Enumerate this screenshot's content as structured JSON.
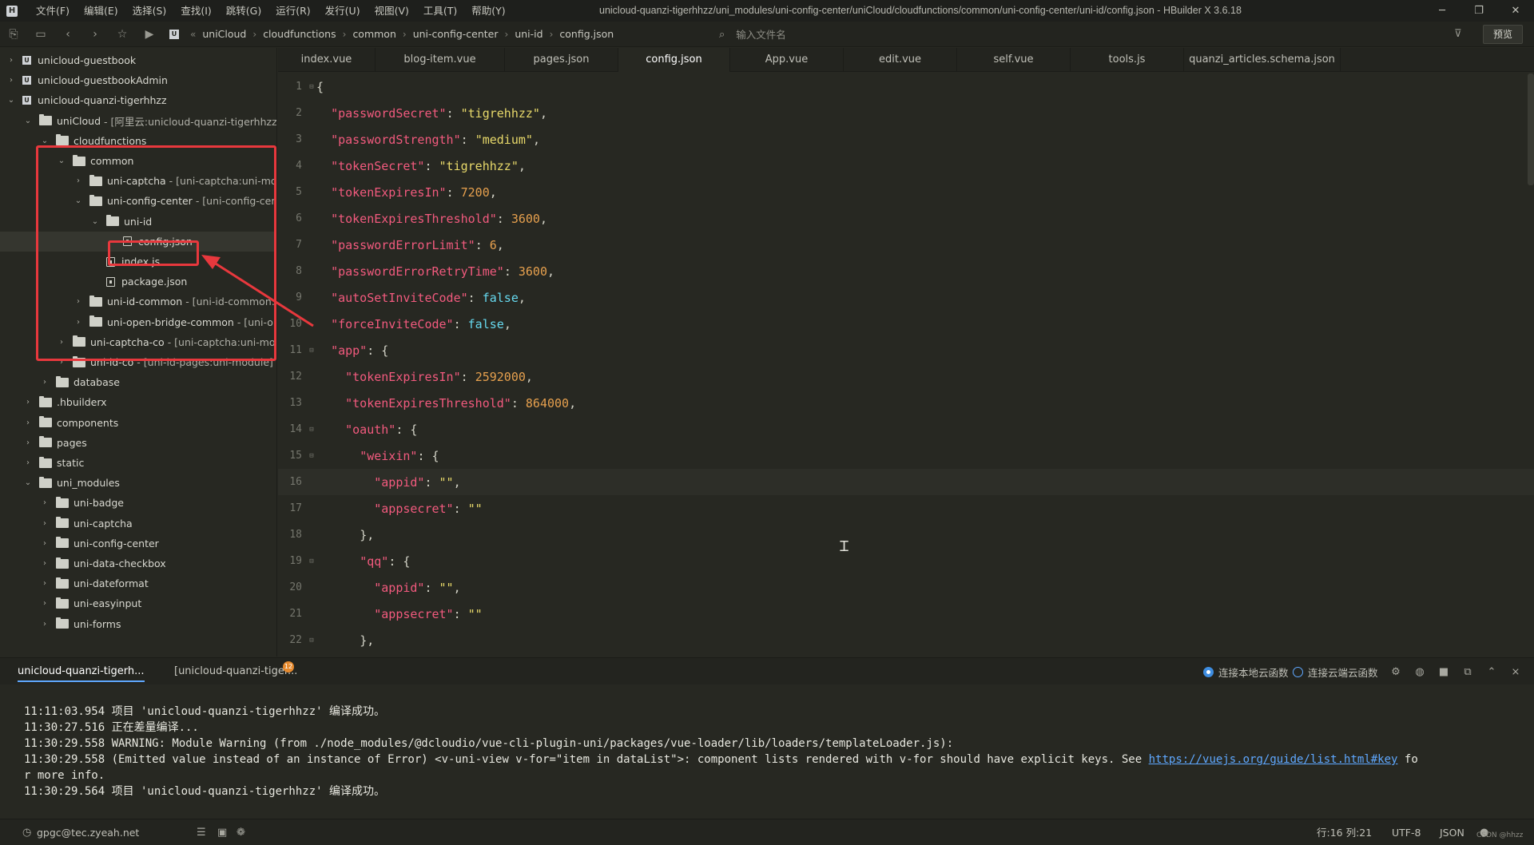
{
  "titlebar": {
    "menu": [
      "文件(F)",
      "编辑(E)",
      "选择(S)",
      "查找(I)",
      "跳转(G)",
      "运行(R)",
      "发行(U)",
      "视图(V)",
      "工具(T)",
      "帮助(Y)"
    ],
    "title": "unicloud-quanzi-tigerhhzz/uni_modules/uni-config-center/uniCloud/cloudfunctions/common/uni-config-center/uni-id/config.json - HBuilder X 3.6.18",
    "controls": [
      "minimize-icon",
      "restore-icon",
      "close-icon"
    ]
  },
  "toolbar": {
    "breadcrumb": [
      "uniCloud",
      "cloudfunctions",
      "common",
      "uni-config-center",
      "uni-id",
      "config.json"
    ],
    "search_placeholder": "输入文件名",
    "preview_label": "预览"
  },
  "sidebar": {
    "tree": [
      {
        "label": "unicloud-guestbook",
        "sub": "",
        "depth": 0,
        "icon": "project",
        "chev": "closed"
      },
      {
        "label": "unicloud-guestbookAdmin",
        "sub": "",
        "depth": 0,
        "icon": "project",
        "chev": "closed"
      },
      {
        "label": "unicloud-quanzi-tigerhhzz",
        "sub": "",
        "depth": 0,
        "icon": "project",
        "chev": "open"
      },
      {
        "label": "uniCloud",
        "sub": "- [阿里云:unicloud-quanzi-tigerhhzz]",
        "depth": 1,
        "icon": "folder",
        "chev": "open"
      },
      {
        "label": "cloudfunctions",
        "sub": "",
        "depth": 2,
        "icon": "folder",
        "chev": "open"
      },
      {
        "label": "common",
        "sub": "",
        "depth": 3,
        "icon": "folder",
        "chev": "open"
      },
      {
        "label": "uni-captcha",
        "sub": "- [uni-captcha:uni-module]",
        "depth": 4,
        "icon": "folder",
        "chev": "closed"
      },
      {
        "label": "uni-config-center",
        "sub": "- [uni-config-center:uni-module]",
        "depth": 4,
        "icon": "folder",
        "chev": "open"
      },
      {
        "label": "uni-id",
        "sub": "",
        "depth": 5,
        "icon": "folder",
        "chev": "open"
      },
      {
        "label": "config.json",
        "sub": "",
        "depth": 6,
        "icon": "file",
        "chev": "none",
        "selected": true
      },
      {
        "label": "index.js",
        "sub": "",
        "depth": 5,
        "icon": "file",
        "chev": "none"
      },
      {
        "label": "package.json",
        "sub": "",
        "depth": 5,
        "icon": "file",
        "chev": "none"
      },
      {
        "label": "uni-id-common",
        "sub": "- [uni-id-common:uni-module]",
        "depth": 4,
        "icon": "folder",
        "chev": "closed"
      },
      {
        "label": "uni-open-bridge-common",
        "sub": "- [uni-open-bridge-common:uni-module]",
        "depth": 4,
        "icon": "folder",
        "chev": "closed"
      },
      {
        "label": "uni-captcha-co",
        "sub": "- [uni-captcha:uni-module]",
        "depth": 3,
        "icon": "folder",
        "chev": "closed"
      },
      {
        "label": "uni-id-co",
        "sub": "- [uni-id-pages:uni-module]",
        "depth": 3,
        "icon": "folder",
        "chev": "closed"
      },
      {
        "label": "database",
        "sub": "",
        "depth": 2,
        "icon": "folder",
        "chev": "closed"
      },
      {
        "label": ".hbuilderx",
        "sub": "",
        "depth": 1,
        "icon": "folder",
        "chev": "closed"
      },
      {
        "label": "components",
        "sub": "",
        "depth": 1,
        "icon": "folder",
        "chev": "closed"
      },
      {
        "label": "pages",
        "sub": "",
        "depth": 1,
        "icon": "folder",
        "chev": "closed"
      },
      {
        "label": "static",
        "sub": "",
        "depth": 1,
        "icon": "folder",
        "chev": "closed"
      },
      {
        "label": "uni_modules",
        "sub": "",
        "depth": 1,
        "icon": "folder",
        "chev": "open"
      },
      {
        "label": "uni-badge",
        "sub": "",
        "depth": 2,
        "icon": "folder",
        "chev": "closed"
      },
      {
        "label": "uni-captcha",
        "sub": "",
        "depth": 2,
        "icon": "folder",
        "chev": "closed"
      },
      {
        "label": "uni-config-center",
        "sub": "",
        "depth": 2,
        "icon": "folder",
        "chev": "closed"
      },
      {
        "label": "uni-data-checkbox",
        "sub": "",
        "depth": 2,
        "icon": "folder",
        "chev": "closed"
      },
      {
        "label": "uni-dateformat",
        "sub": "",
        "depth": 2,
        "icon": "folder",
        "chev": "closed"
      },
      {
        "label": "uni-easyinput",
        "sub": "",
        "depth": 2,
        "icon": "folder",
        "chev": "closed"
      },
      {
        "label": "uni-forms",
        "sub": "",
        "depth": 2,
        "icon": "folder",
        "chev": "closed"
      }
    ],
    "bottom_icons": [
      "project-panel-icon",
      "debug-icon",
      "refresh-icon",
      "network-icon"
    ]
  },
  "tabs": [
    "index.vue",
    "blog-item.vue",
    "pages.json",
    "config.json",
    "App.vue",
    "edit.vue",
    "self.vue",
    "tools.js",
    "quanzi_articles.schema.json"
  ],
  "active_tab": "config.json",
  "editor": {
    "current_line": 16,
    "lines": [
      {
        "n": "1",
        "fold": true,
        "html": "<span class=\"p\">{</span>"
      },
      {
        "n": "2",
        "fold": false,
        "html": "  <span class=\"k\">\"passwordSecret\"</span><span class=\"p\">: </span><span class=\"s\">\"tigrehhzz\"</span><span class=\"p\">,</span>"
      },
      {
        "n": "3",
        "fold": false,
        "html": "  <span class=\"k\">\"passwordStrength\"</span><span class=\"p\">: </span><span class=\"s\">\"medium\"</span><span class=\"p\">,</span>"
      },
      {
        "n": "4",
        "fold": false,
        "html": "  <span class=\"k\">\"tokenSecret\"</span><span class=\"p\">: </span><span class=\"s\">\"tigrehhzz\"</span><span class=\"p\">,</span>"
      },
      {
        "n": "5",
        "fold": false,
        "html": "  <span class=\"k\">\"tokenExpiresIn\"</span><span class=\"p\">: </span><span class=\"n\">7200</span><span class=\"p\">,</span>"
      },
      {
        "n": "6",
        "fold": false,
        "html": "  <span class=\"k\">\"tokenExpiresThreshold\"</span><span class=\"p\">: </span><span class=\"n\">3600</span><span class=\"p\">,</span>"
      },
      {
        "n": "7",
        "fold": false,
        "html": "  <span class=\"k\">\"passwordErrorLimit\"</span><span class=\"p\">: </span><span class=\"n\">6</span><span class=\"p\">,</span>"
      },
      {
        "n": "8",
        "fold": false,
        "html": "  <span class=\"k\">\"passwordErrorRetryTime\"</span><span class=\"p\">: </span><span class=\"n\">3600</span><span class=\"p\">,</span>"
      },
      {
        "n": "9",
        "fold": false,
        "html": "  <span class=\"k\">\"autoSetInviteCode\"</span><span class=\"p\">: </span><span class=\"b\">false</span><span class=\"p\">,</span>"
      },
      {
        "n": "10",
        "fold": false,
        "html": "  <span class=\"k\">\"forceInviteCode\"</span><span class=\"p\">: </span><span class=\"b\">false</span><span class=\"p\">,</span>"
      },
      {
        "n": "11",
        "fold": true,
        "html": "  <span class=\"k\">\"app\"</span><span class=\"p\">: {</span>"
      },
      {
        "n": "12",
        "fold": false,
        "html": "    <span class=\"k\">\"tokenExpiresIn\"</span><span class=\"p\">: </span><span class=\"n\">2592000</span><span class=\"p\">,</span>"
      },
      {
        "n": "13",
        "fold": false,
        "html": "    <span class=\"k\">\"tokenExpiresThreshold\"</span><span class=\"p\">: </span><span class=\"n\">864000</span><span class=\"p\">,</span>"
      },
      {
        "n": "14",
        "fold": true,
        "html": "    <span class=\"k\">\"oauth\"</span><span class=\"p\">: {</span>"
      },
      {
        "n": "15",
        "fold": true,
        "html": "      <span class=\"k\">\"weixin\"</span><span class=\"p\">: {</span>"
      },
      {
        "n": "16",
        "fold": false,
        "html": "        <span class=\"k\">\"appid\"</span><span class=\"p\">: </span><span class=\"s\">\"\"</span><span class=\"p\">,</span>"
      },
      {
        "n": "17",
        "fold": false,
        "html": "        <span class=\"k\">\"appsecret\"</span><span class=\"p\">: </span><span class=\"s\">\"\"</span>"
      },
      {
        "n": "18",
        "fold": false,
        "html": "      <span class=\"p\">},</span>"
      },
      {
        "n": "19",
        "fold": true,
        "html": "      <span class=\"k\">\"qq\"</span><span class=\"p\">: {</span>"
      },
      {
        "n": "20",
        "fold": false,
        "html": "        <span class=\"k\">\"appid\"</span><span class=\"p\">: </span><span class=\"s\">\"\"</span><span class=\"p\">,</span>"
      },
      {
        "n": "21",
        "fold": false,
        "html": "        <span class=\"k\">\"appsecret\"</span><span class=\"p\">: </span><span class=\"s\">\"\"</span>"
      },
      {
        "n": "22",
        "fold": true,
        "html": "      <span class=\"p\">},</span>"
      }
    ]
  },
  "console": {
    "tabs": [
      "unicloud-quanzi-tigerh...",
      "[unicloud-quanzi-tiger..."
    ],
    "badge": "12",
    "cloud_local": "连接本地云函数",
    "cloud_remote": "连接云端云函数",
    "lines": [
      "11:11:03.954 项目 'unicloud-quanzi-tigerhhzz' 编译成功。",
      "11:30:27.516 正在差量编译...",
      "11:30:29.558 WARNING: Module Warning (from ./node_modules/@dcloudio/vue-cli-plugin-uni/packages/vue-loader/lib/loaders/templateLoader.js):",
      "11:30:29.558 (Emitted value instead of an instance of Error) <v-uni-view v-for=\"item in dataList\">: component lists rendered with v-for should have explicit keys. See ",
      "r more info.",
      "11:30:29.564 项目 'unicloud-quanzi-tigerhhzz' 编译成功。"
    ],
    "link_text": "https://vuejs.org/guide/list.html#key",
    "link_tail": " fo"
  },
  "statusbar": {
    "user": "gpgc@tec.zyeah.net",
    "position": "行:16  列:21",
    "encoding": "UTF-8",
    "language": "JSON",
    "watermark": "CSDN @hhzz"
  },
  "colors": {
    "accent": "#5fa8ff",
    "highlight": "#e8383d",
    "background": "#272822"
  }
}
